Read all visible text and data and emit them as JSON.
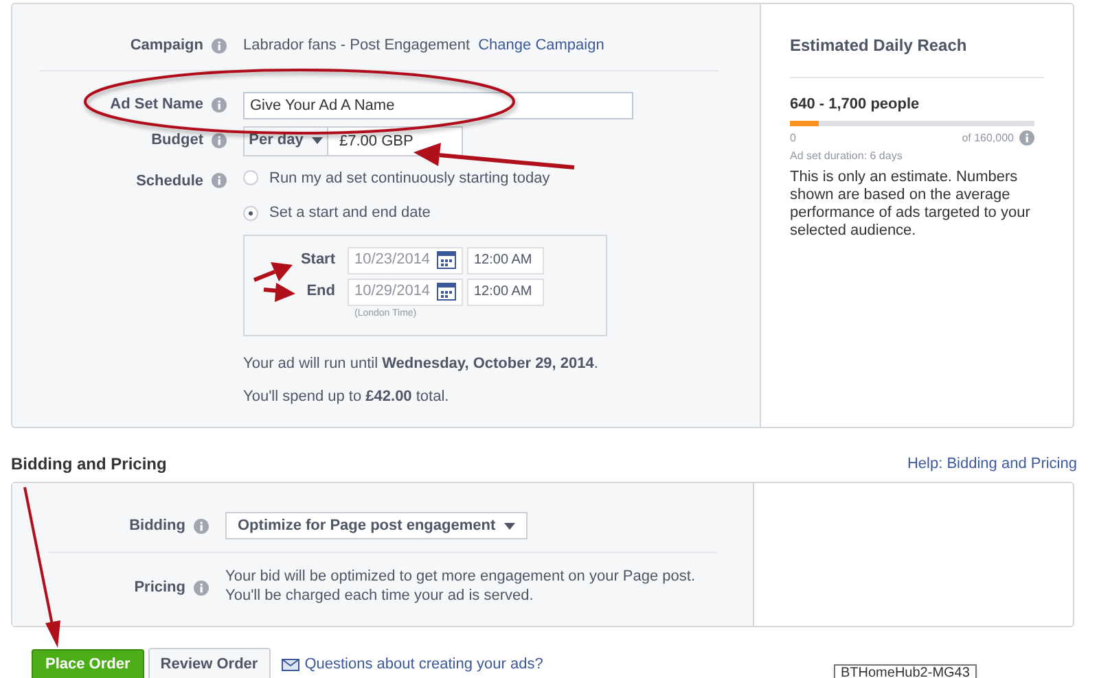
{
  "campaign": {
    "label": "Campaign",
    "value": "Labrador fans - Post Engagement",
    "link": "Change Campaign"
  },
  "ad_set_name": {
    "label": "Ad Set Name",
    "value": "Give Your Ad A Name"
  },
  "budget": {
    "label": "Budget",
    "period": "Per day",
    "value": "£7.00 GBP"
  },
  "schedule": {
    "label": "Schedule",
    "options": [
      {
        "label": "Run my ad set continuously starting today",
        "selected": false
      },
      {
        "label": "Set a start and end date",
        "selected": true
      }
    ],
    "dates": [
      {
        "label": "Start",
        "date": "10/23/2014",
        "time": "12:00 AM"
      },
      {
        "label": "End",
        "date": "10/29/2014",
        "time": "12:00 AM"
      }
    ],
    "timezone": "(London Time)",
    "summary": [
      "Your ad will run until **Wednesday, October 29, 2014**.",
      "You'll spend up to **£42.00** total."
    ]
  },
  "reach": {
    "title": "Estimated Daily Reach",
    "range": "640 - 1,700 people",
    "level": 0.12,
    "min": "0",
    "max": "of 160,000",
    "duration": "Ad set duration: 6 days",
    "note": "This is only an estimate. Numbers shown are based on the average performance of ads targeted to your selected audience."
  },
  "bidding_pricing": {
    "title": "Bidding and Pricing",
    "help_link": "Help: Bidding and Pricing",
    "bidding_label": "Bidding",
    "bidding_value": "Optimize for Page post engagement",
    "pricing_label": "Pricing",
    "pricing_text": "Your bid will be optimized to get more engagement on your Page post. You'll be charged each time your ad is served."
  },
  "buttons": [
    {
      "label": "Place Order",
      "kind": "primary"
    },
    {
      "label": "Review Order",
      "kind": "secondary"
    }
  ],
  "help_link": "Questions about creating your ads?",
  "tooltip": "BTHomeHub2-MG43"
}
